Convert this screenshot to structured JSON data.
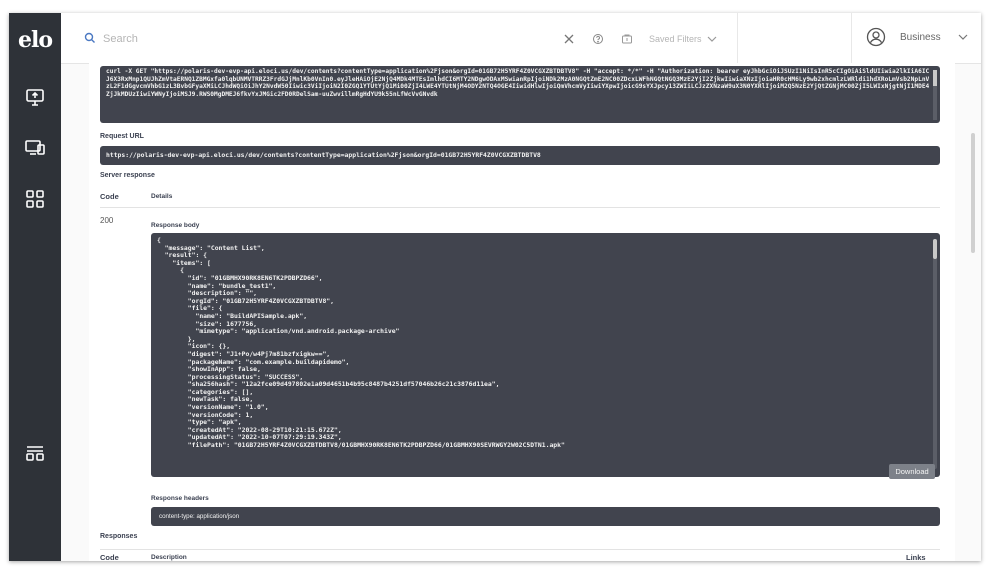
{
  "app": {
    "logo_text": "elo"
  },
  "sidebar": {
    "items": [
      {
        "icon": "device-upload-icon"
      },
      {
        "icon": "devices-icon"
      },
      {
        "icon": "apps-grid-icon"
      },
      {
        "icon": "menu-stack-icon"
      }
    ]
  },
  "topbar": {
    "search_placeholder": "Search",
    "saved_filters_label": "Saved Filters",
    "account_label": "Business"
  },
  "request": {
    "curl_command": "curl -X GET \"https://polaris-dev-evp-api.eloci.us/dev/contents?contentType=application%2Fjson&orgId=01GB72H5YRF4Z0VCGXZBTDBTV8\" -H \"accept: */*\" -H \"Authorization: bearer eyJhbGciOiJSUzI1NiIsInR5cCIgOiAiSldUIiwia2lkIiA6ICJ6X3RxMnp1QUJhZmVtaERNQ1ZBMGxfa0lqbUNMVTRRZ3FrdGJjMnlKb0VnIn0.eyJleHAiOjE2NjQ4MDk4MTEsImlhdCI6MTY2NDgwODAxMSwianRpIjoiNDk2MzA0NGQtZmE2NC00ZDcxLWFhNGQtNGQ3MzE2YjI2ZjkwIiwiaXNzIjoiaHR0cHM6Ly9wb2xhcmlzLWRldi1hdXRoLmVsb2NpLnVzL2F1dGgvcmVhbG1zL3BvbGFyaXMiLCJhdWQiOiJhY2NvdW50Iiwic3ViIjoiN2I0ZGQ1YTUtYjQ1Mi00ZjI4LWE4YTUtNjM4ODY2NTQ4OGE4IiwidHlwIjoiQmVhcmVyIiwiYXpwIjoicG9sYXJpcy13ZWIiLCJzZXNzaW9uX3N0YXRlIjoiM2Q5NzE2YjQtZGNjMC00ZjI5LWIxNjgtNjI1MDE4ZjJkMDUzIiwiYWNyIjoiMSJ9.RWS0MgDMEJ6fkvYxJMGic2FD0RDelSam-uuZwvillmRgHdYU9k55nLfWcVvGNvdk",
    "request_url_label": "Request URL",
    "request_url": "https://polaris-dev-evp-api.eloci.us/dev/contents?contentType=application%2Fjson&orgId=01GB72H5YRF4Z0VCGXZBTDBTV8"
  },
  "server_response": {
    "label": "Server response",
    "col_code": "Code",
    "col_details": "Details",
    "code": "200",
    "response_body_label": "Response body",
    "body_lines": [
      "{",
      "  \"message\": \"Content List\",",
      "  \"result\": {",
      "    \"items\": [",
      "      {",
      "        \"id\": \"01GBMHX90RK8EN6TK2PDBPZD66\",",
      "        \"name\": \"bundle_test1\",",
      "        \"description\": \"\",",
      "        \"orgId\": \"01GB72H5YRF4Z0VCGXZBTDBTV8\",",
      "        \"file\": {",
      "          \"name\": \"BuildAPISample.apk\",",
      "          \"size\": 1677756,",
      "          \"mimetype\": \"application/vnd.android.package-archive\"",
      "        },",
      "        \"icon\": {},",
      "        \"digest\": \"J1+Po/w4Pj7m81bzfxigkw==\",",
      "        \"packageName\": \"com.example.buildapidemo\",",
      "        \"showInApp\": false,",
      "        \"processingStatus\": \"SUCCESS\",",
      "        \"sha256hash\": \"12a2fce09d497802e1a09d4651b4b95c8487b4251df57046b26c21c3876d11ea\",",
      "        \"categories\": [],",
      "        \"newTask\": false,",
      "        \"versionName\": \"1.0\",",
      "        \"versionCode\": 1,",
      "        \"type\": \"apk\",",
      "        \"createdAt\": \"2022-08-29T10:21:15.672Z\",",
      "        \"updatedAt\": \"2022-10-07T07:29:19.343Z\",",
      "        \"filePath\": \"01GB72H5YRF4Z0VCGXZBTDBTV8/01GBMHX90RK8EN6TK2PDBPZD66/01GBMHX90SEVRWGY2W02C5DTN1.apk\""
    ],
    "download_label": "Download",
    "response_headers_label": "Response headers",
    "response_headers": "content-type: application/json"
  },
  "responses": {
    "label": "Responses",
    "col_code": "Code",
    "col_description": "Description",
    "col_links": "Links"
  }
}
